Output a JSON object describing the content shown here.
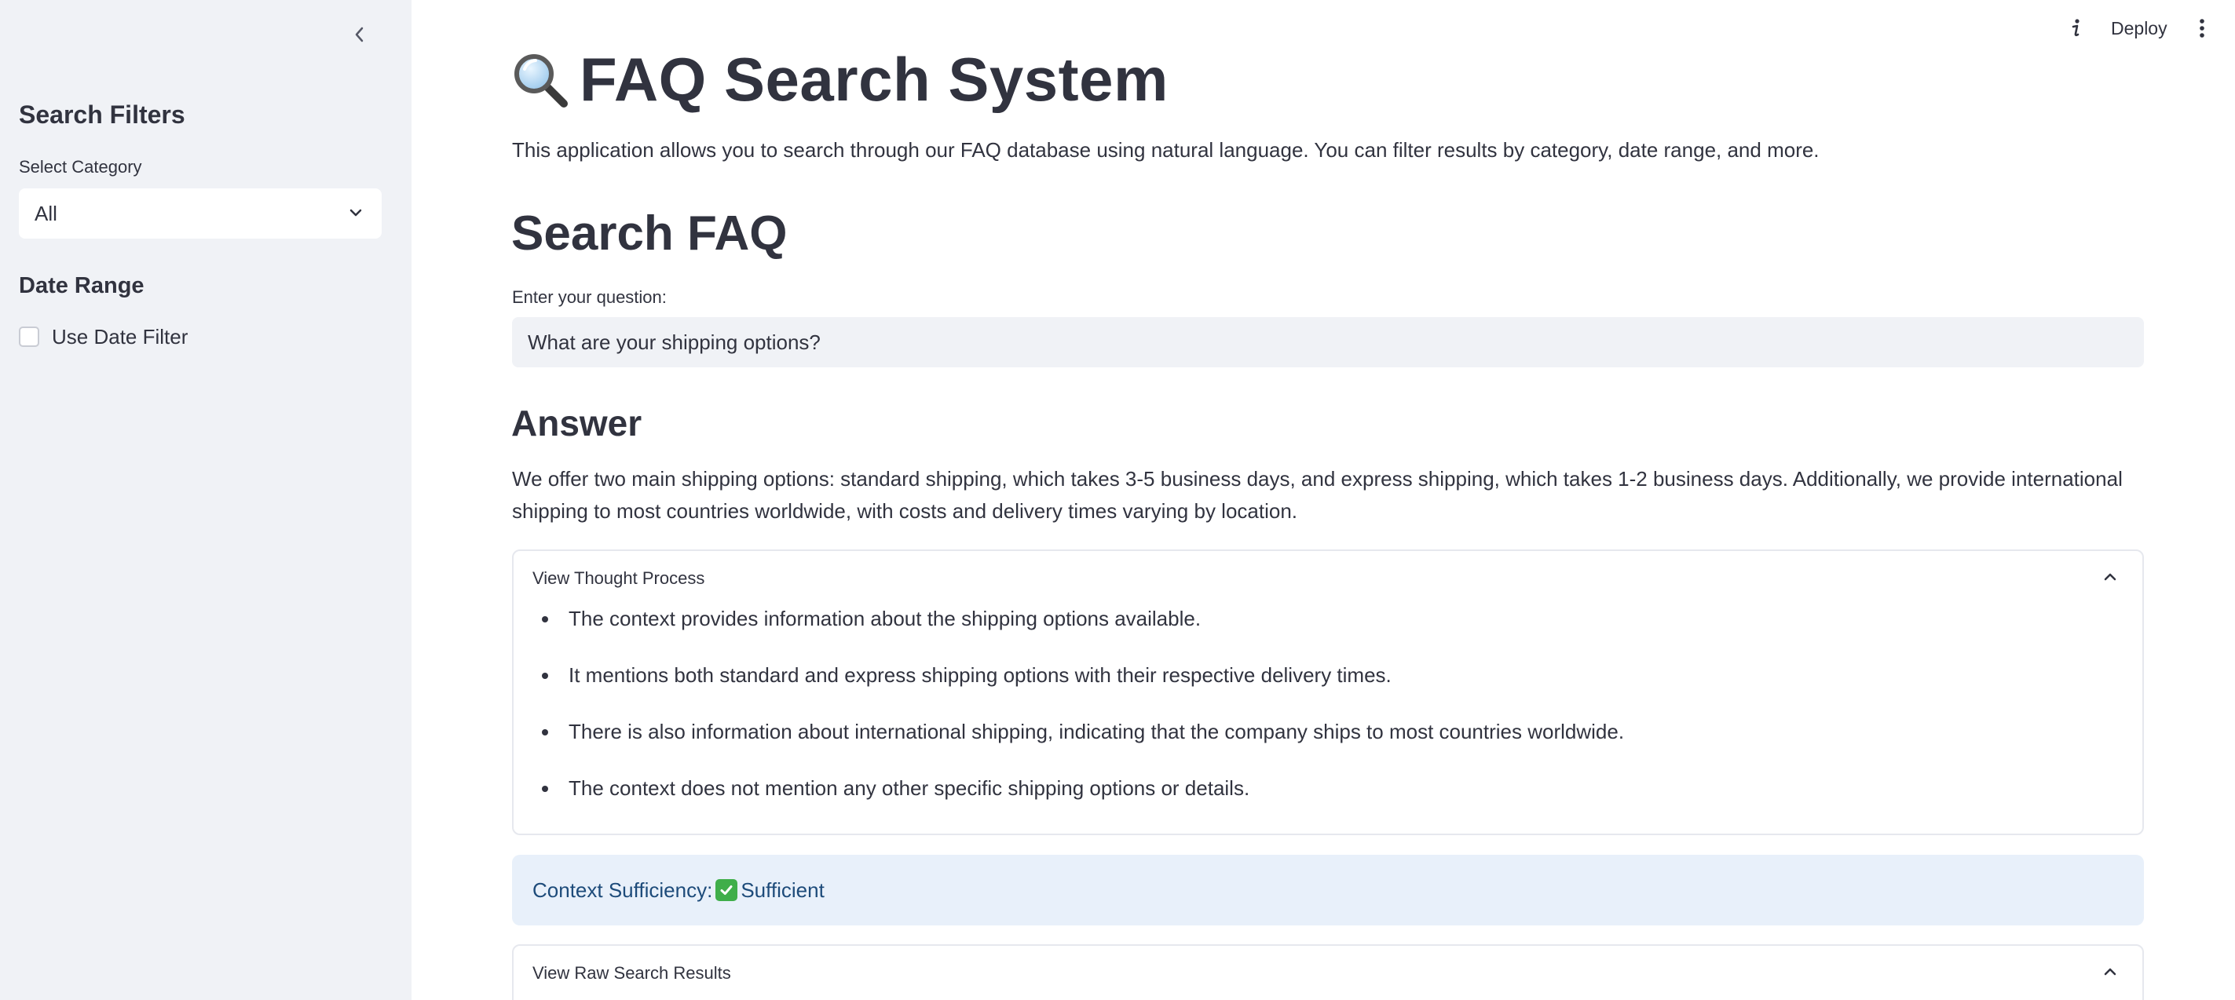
{
  "sidebar": {
    "title": "Search Filters",
    "category_label": "Select Category",
    "category_selected": "All",
    "date_title": "Date Range",
    "date_filter_label": "Use Date Filter"
  },
  "toolbar": {
    "deploy_label": "Deploy"
  },
  "main": {
    "title": "FAQ Search System",
    "intro": "This application allows you to search through our FAQ database using natural language. You can filter results by category, date range, and more.",
    "search_heading": "Search FAQ",
    "input_label": "Enter your question:",
    "question_value": "What are your shipping options?",
    "answer_heading": "Answer",
    "answer_text": "We offer two main shipping options: standard shipping, which takes 3-5 business days, and express shipping, which takes 1-2 business days. Additionally, we provide international shipping to most countries worldwide, with costs and delivery times varying by location.",
    "thought_expander_label": "View Thought Process",
    "thought_points": [
      "The context provides information about the shipping options available.",
      "It mentions both standard and express shipping options with their respective delivery times.",
      "There is also information about international shipping, indicating that the company ships to most countries worldwide.",
      "The context does not mention any other specific shipping options or details."
    ],
    "sufficiency_label": "Context Sufficiency:",
    "sufficiency_value": "Sufficient",
    "raw_expander_label": "View Raw Search Results"
  },
  "colors": {
    "sidebar_bg": "#f0f2f6",
    "text": "#31333f",
    "alert_bg": "#e8f0fa",
    "alert_text": "#1d4b7a",
    "check_green": "#3fae4a"
  },
  "icons": [
    "chevron-left-icon",
    "chevron-down-icon",
    "info-icon",
    "more-vert-icon",
    "magnifier-icon",
    "chevron-up-icon",
    "check-icon"
  ]
}
